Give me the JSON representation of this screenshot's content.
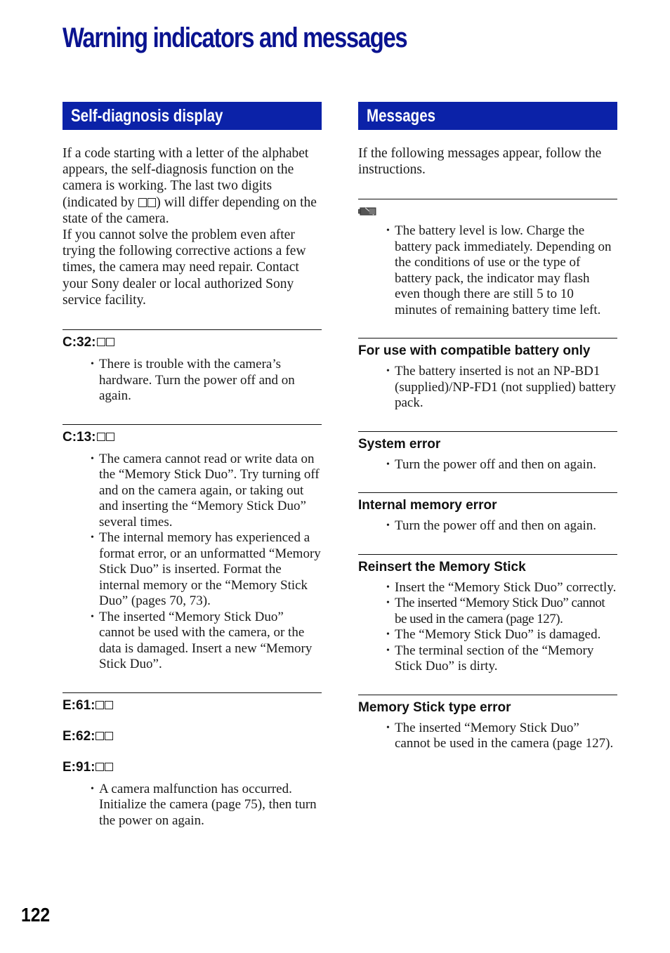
{
  "page": {
    "title": "Warning indicators and messages",
    "page_number": "122",
    "colors": {
      "title": "#0a1390",
      "section_bar": "#0b22a8",
      "section_bar_text": "#ffffff"
    }
  },
  "left": {
    "heading": "Self-diagnosis display",
    "intro_p1_a": "If a code starting with a letter of the alphabet appears, the self-diagnosis function on the camera is working. The last two digits (indicated by ",
    "intro_p1_b": ") will differ depending on the state of the camera.",
    "intro_p2": "If you cannot solve the problem even after trying the following corrective actions a few times, the camera may need repair. Contact your Sony dealer or local authorized Sony service facility.",
    "entries": [
      {
        "codes": [
          "C:32:"
        ],
        "bullets": [
          "There is trouble with the camera’s hardware. Turn the power off and on again."
        ]
      },
      {
        "codes": [
          "C:13:"
        ],
        "bullets": [
          "The camera cannot read or write data on the “Memory Stick Duo”. Try turning off and on the camera again, or taking out and inserting the “Memory Stick Duo” several times.",
          "The internal memory has experienced a format error, or an unformatted “Memory Stick Duo” is inserted. Format the internal memory or the “Memory Stick Duo” (pages 70, 73).",
          "The inserted “Memory Stick Duo” cannot be used with the camera, or the data is damaged. Insert a new “Memory Stick Duo”."
        ]
      },
      {
        "codes": [
          "E:61:",
          "E:62:",
          "E:91:"
        ],
        "bullets": [
          "A camera malfunction has occurred. Initialize the camera (page 75), then turn the power on again."
        ]
      }
    ]
  },
  "right": {
    "heading": "Messages",
    "intro": "If the following messages appear, follow the instructions.",
    "battery_icon": "low-battery-icon",
    "entries": [
      {
        "title": "",
        "icon": "low-battery-icon",
        "bullets": [
          "The battery level is low. Charge the battery pack immediately. Depending on the conditions of use or the type of battery pack, the indicator may flash even though there are still 5 to 10 minutes of remaining battery time left."
        ]
      },
      {
        "title": "For use with compatible battery only",
        "bullets": [
          "The battery inserted is not an NP-BD1 (supplied)/NP-FD1 (not supplied) battery pack."
        ]
      },
      {
        "title": "System error",
        "bullets": [
          "Turn the power off and then on again."
        ]
      },
      {
        "title": "Internal memory error",
        "bullets": [
          "Turn the power off and then on again."
        ]
      },
      {
        "title": "Reinsert the Memory Stick",
        "bullets": [
          "Insert the “Memory Stick Duo” correctly.",
          "The inserted “Memory Stick Duo” cannot be used in the camera (page 127).",
          "The “Memory Stick Duo” is damaged.",
          "The terminal section of the “Memory Stick Duo” is dirty."
        ]
      },
      {
        "title": "Memory Stick type error",
        "bullets": [
          "The inserted “Memory Stick Duo” cannot be used in the camera (page 127)."
        ]
      }
    ]
  }
}
